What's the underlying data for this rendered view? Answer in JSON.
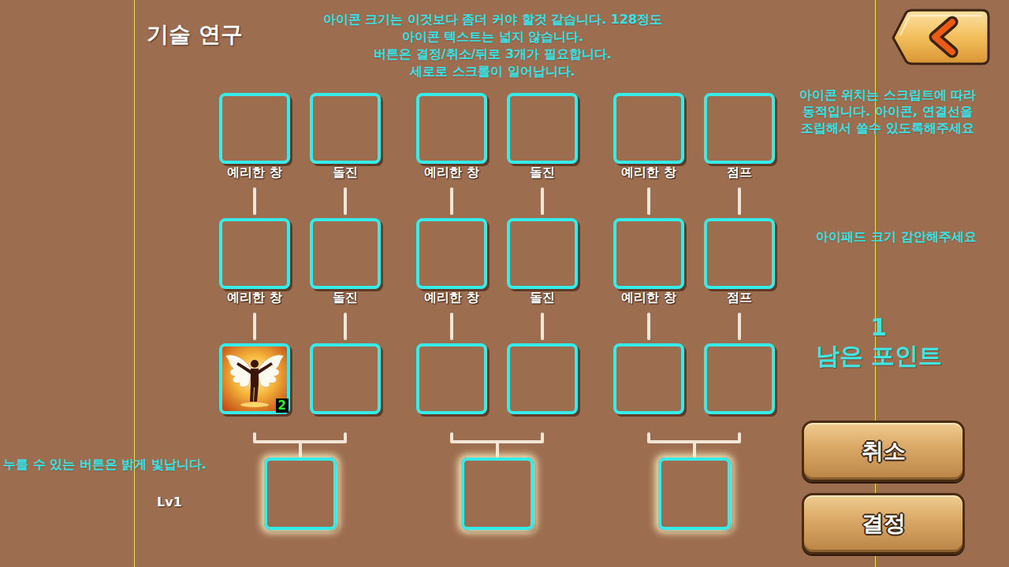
{
  "title": "기술 연구",
  "notes": {
    "top": [
      "아이콘 크기는 이것보다 좀더 커야 할것 같습니다. 128정도",
      "아이콘 텍스트는 넓지 않습니다.",
      "버튼은 결정/취소/뒤로 3개가 필요합니다.",
      "세로로 스크롤이 일어납니다."
    ],
    "right": [
      "아이콘 위치는 스크립트에 따라",
      "동적입니다. 아이콘, 연결선을",
      "조립해서 쓸수 있도록해주세요"
    ],
    "ipad": "아이패드 크기 감안해주세요",
    "press": "누를 수 있는 버튼은 밝게 빛납니다."
  },
  "level": "Lv1",
  "points": {
    "value": "1",
    "label": "남은 포인트"
  },
  "groups": [
    {
      "columns": [
        {
          "slots": [
            {
              "label": "예리한 창",
              "filled": false
            },
            {
              "label": "예리한 창",
              "filled": false
            },
            {
              "filled": true,
              "badge": "2"
            }
          ]
        },
        {
          "slots": [
            {
              "label": "돌진",
              "filled": false
            },
            {
              "label": "돌진",
              "filled": false
            },
            {
              "filled": false
            }
          ]
        }
      ],
      "final": {
        "glowing": true
      }
    },
    {
      "columns": [
        {
          "slots": [
            {
              "label": "예리한 창",
              "filled": false
            },
            {
              "label": "예리한 창",
              "filled": false
            },
            {
              "filled": false
            }
          ]
        },
        {
          "slots": [
            {
              "label": "돌진",
              "filled": false
            },
            {
              "label": "돌진",
              "filled": false
            },
            {
              "filled": false
            }
          ]
        }
      ],
      "final": {
        "glowing": true
      }
    },
    {
      "columns": [
        {
          "slots": [
            {
              "label": "예리한 창",
              "filled": false
            },
            {
              "label": "예리한 창",
              "filled": false
            },
            {
              "filled": false
            }
          ]
        },
        {
          "slots": [
            {
              "label": "점프",
              "filled": false
            },
            {
              "label": "점프",
              "filled": false
            },
            {
              "filled": false
            }
          ]
        }
      ],
      "final": {
        "glowing": true
      }
    }
  ],
  "buttons": [
    {
      "label": "취소"
    },
    {
      "label": "결정"
    }
  ]
}
